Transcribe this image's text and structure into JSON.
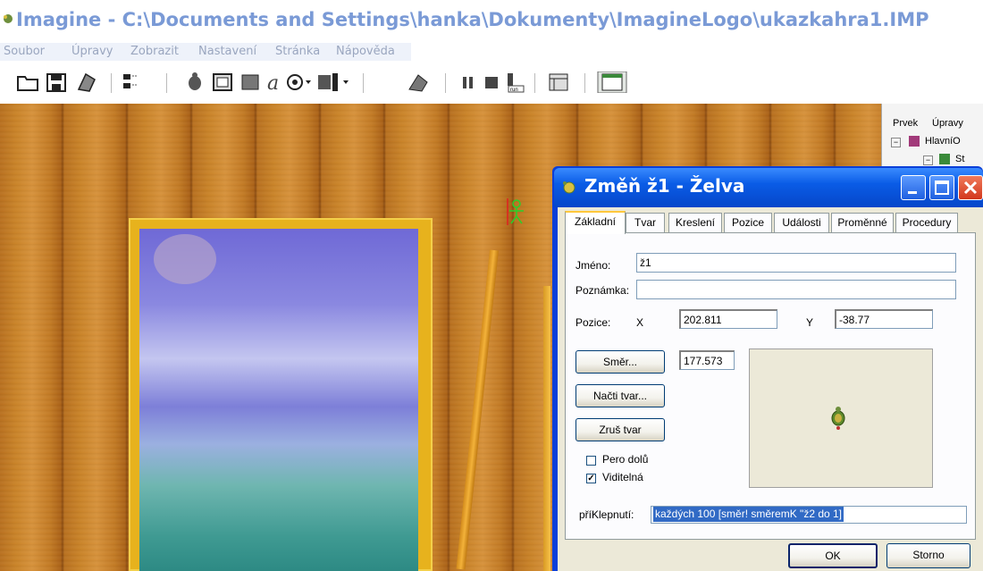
{
  "window": {
    "title": "Imagine - C:\\Documents and Settings\\hanka\\Dokumenty\\ImagineLogo\\ukazkahra1.IMP"
  },
  "menu": [
    "Soubor",
    "Úpravy",
    "Zobrazit",
    "Nastavení",
    "Stránka",
    "Nápověda"
  ],
  "toolbar": {
    "icons": [
      "open-folder-icon",
      "save-icon",
      "globe-icon",
      "page-list-icon",
      "turtle-icon",
      "square-outline-icon",
      "filled-square-icon",
      "text-icon",
      "dial-icon",
      "character-icon",
      "turtle-paint-icon",
      "pause-icon",
      "stop-icon",
      "run-icon",
      "pages-icon",
      "window-icon"
    ],
    "run_label": "run"
  },
  "right_panel": {
    "menu": [
      "Prvek",
      "Úpravy"
    ],
    "tree": [
      "HlavníO",
      "St"
    ]
  },
  "dialog": {
    "title": "Změň ž1  - Želva",
    "tabs": [
      "Základní",
      "Tvar",
      "Kreslení",
      "Pozice",
      "Události",
      "Proměnné",
      "Procedury"
    ],
    "active_tab": "Základní",
    "name_label": "Jméno:",
    "name_value": "ž1",
    "note_label": "Poznámka:",
    "note_value": "",
    "position_label": "Pozice:",
    "x_label": "X",
    "x_value": "202.811",
    "y_label": "Y",
    "y_value": "-38.77",
    "direction_button": "Směr...",
    "direction_value": "177.573",
    "load_shape_button": "Načti tvar...",
    "clear_shape_button": "Zruš tvar",
    "pen_down_label": "Pero dolů",
    "pen_down_checked": false,
    "visible_label": "Viditelná",
    "visible_checked": true,
    "on_click_label": "příKlepnutí:",
    "on_click_value": "každých 100 [směr! směremK \"ž2 do 1]",
    "ok_button": "OK",
    "cancel_button": "Storno"
  },
  "colors": {
    "title_text": "#7a9ad6",
    "dialog_titlebar": "#0a5ce6",
    "close_button": "#e2452b",
    "selection": "#316ac5"
  }
}
